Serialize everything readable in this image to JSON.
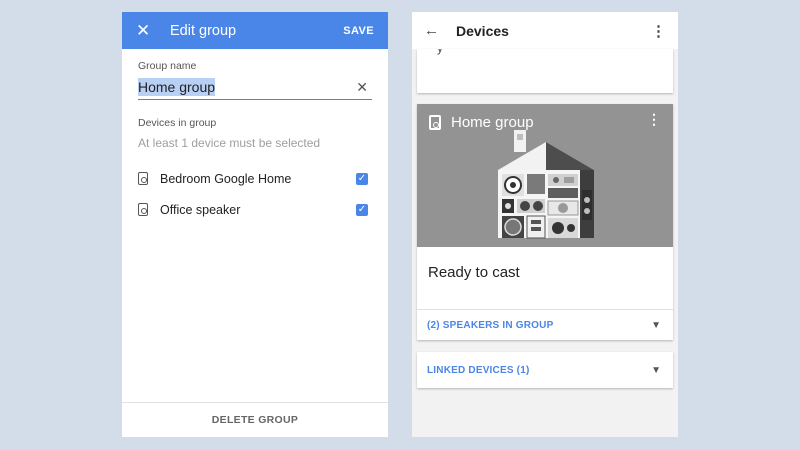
{
  "edit_screen": {
    "title": "Edit group",
    "save_label": "SAVE",
    "close_icon": "close-icon",
    "group_name_label": "Group name",
    "group_name_value": "Home group",
    "devices_label": "Devices in group",
    "hint": "At least 1 device must be selected",
    "devices": [
      {
        "name": "Bedroom Google Home",
        "checked": true
      },
      {
        "name": "Office speaker",
        "checked": true
      }
    ],
    "delete_label": "DELETE GROUP"
  },
  "devices_screen": {
    "title": "Devices",
    "partial_text": "y",
    "group_card": {
      "title": "Home group",
      "status": "Ready to cast",
      "speakers_row": "(2) SPEAKERS IN GROUP"
    },
    "linked_devices": "LINKED DEVICES (1)"
  },
  "colors": {
    "accent": "#4a86e8",
    "background": "#d2dde9",
    "hero": "#939393"
  }
}
